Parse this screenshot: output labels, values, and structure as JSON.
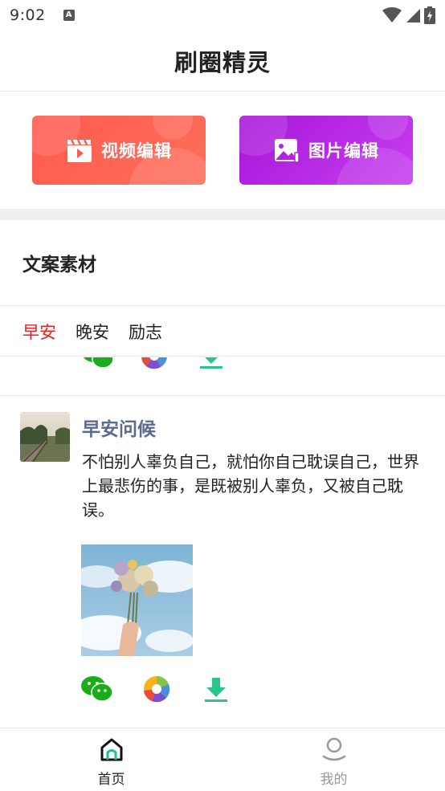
{
  "status_bar": {
    "time": "9:02",
    "notification_icon": "A"
  },
  "header": {
    "title": "刷圈精灵"
  },
  "actions": {
    "video_label": "视频编辑",
    "image_label": "图片编辑",
    "video_color": "#ff5a4e",
    "image_color": "#b422e2"
  },
  "section": {
    "title": "文案素材"
  },
  "tabs": [
    {
      "label": "早安",
      "active": true
    },
    {
      "label": "晚安",
      "active": false
    },
    {
      "label": "励志",
      "active": false
    }
  ],
  "post": {
    "title": "早安问候",
    "body": "不怕别人辜负自己，就怕你自己耽误自己，世界上最悲伤的事，是既被别人辜负，又被自己耽误。",
    "actions": [
      "wechat-icon",
      "moments-icon",
      "download-icon"
    ]
  },
  "bottom_nav": [
    {
      "label": "首页",
      "icon": "home-icon",
      "active": true
    },
    {
      "label": "我的",
      "icon": "profile-icon",
      "active": false
    }
  ],
  "colors": {
    "accent_red": "#e8211e",
    "title_blue": "#5a6a94",
    "wechat_green": "#1aad19",
    "download_green": "#2ac58a"
  }
}
